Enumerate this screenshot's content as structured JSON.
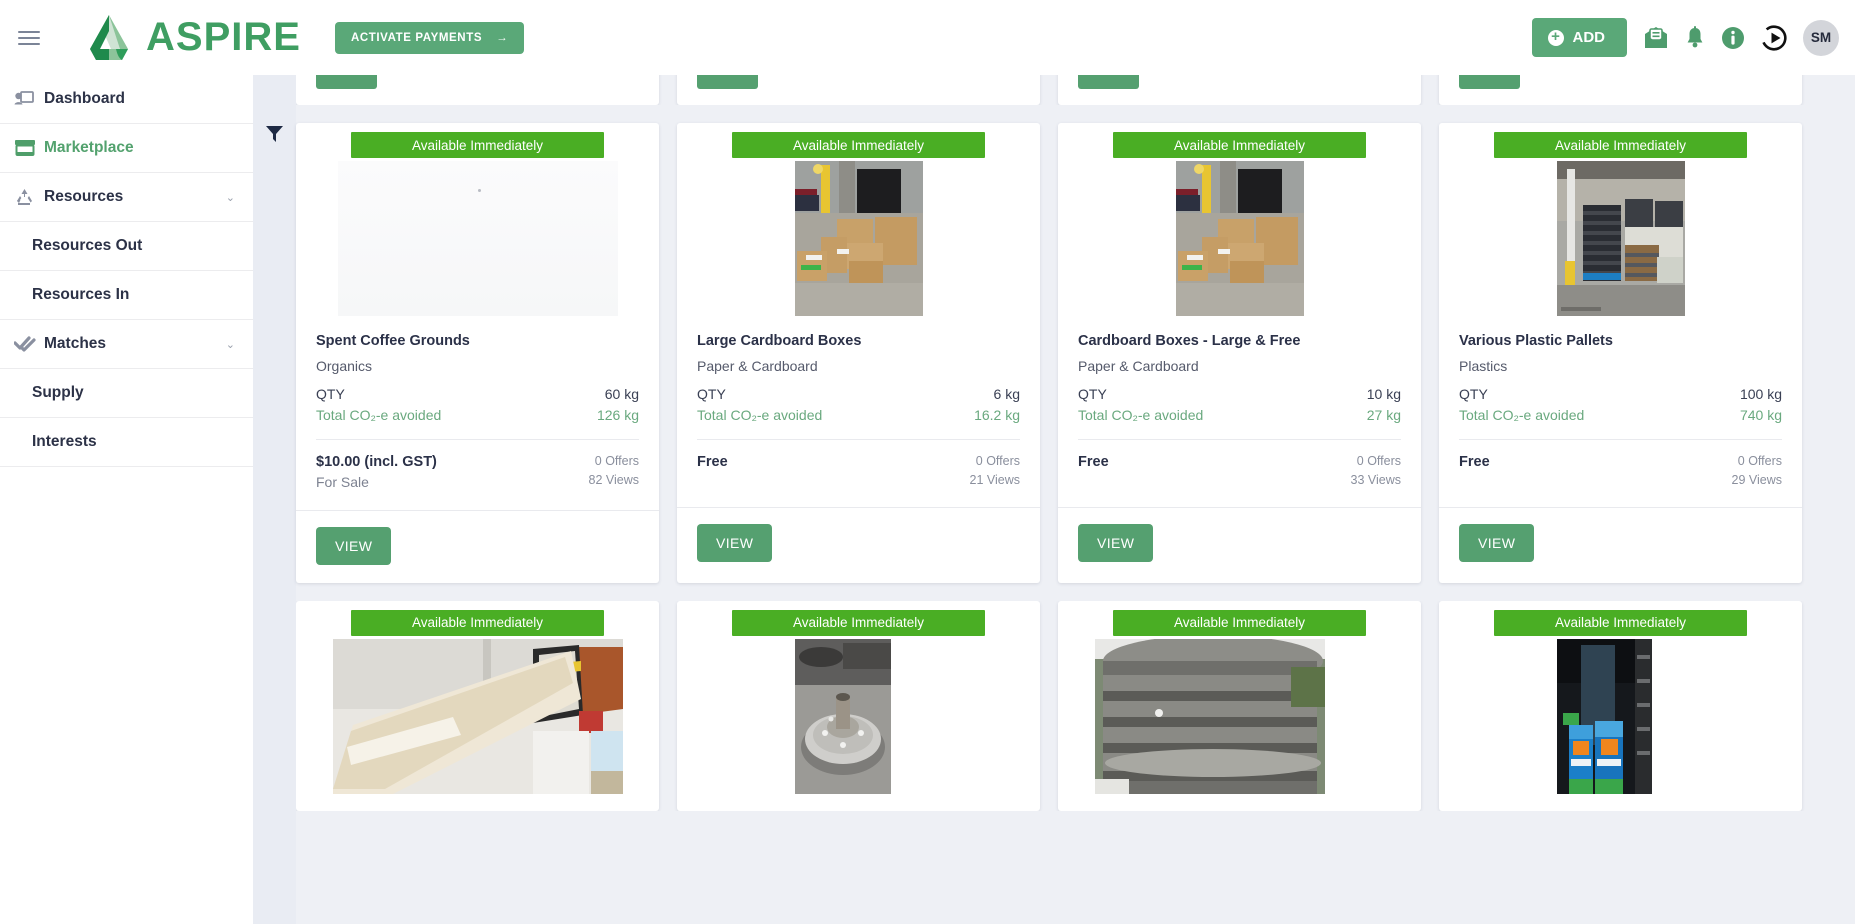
{
  "header": {
    "brand_name": "ASPIRE",
    "activate_label": "ACTIVATE PAYMENTS",
    "activate_arrow": "→",
    "add_label": "ADD",
    "avatar_initials": "SM",
    "icons": [
      "menu-icon",
      "aspire-logo-icon",
      "message-icon",
      "bell-icon",
      "info-icon",
      "play-icon"
    ]
  },
  "sidebar": {
    "items": [
      {
        "label": "Dashboard",
        "icon": "dashboard-icon",
        "active": false,
        "sub": false,
        "chevron": ""
      },
      {
        "label": "Marketplace",
        "icon": "store-icon",
        "active": true,
        "sub": false,
        "chevron": ""
      },
      {
        "label": "Resources",
        "icon": "recycle-icon",
        "active": false,
        "sub": false,
        "chevron": "⌄"
      },
      {
        "label": "Resources Out",
        "icon": "",
        "active": false,
        "sub": true,
        "chevron": ""
      },
      {
        "label": "Resources In",
        "icon": "",
        "active": false,
        "sub": true,
        "chevron": ""
      },
      {
        "label": "Matches",
        "icon": "double-check-icon",
        "active": false,
        "sub": false,
        "chevron": "⌄"
      },
      {
        "label": "Supply",
        "icon": "",
        "active": false,
        "sub": true,
        "chevron": ""
      },
      {
        "label": "Interests",
        "icon": "",
        "active": false,
        "sub": true,
        "chevron": ""
      }
    ]
  },
  "main": {
    "filter_icon": "filter-funnel-icon",
    "view_label": "VIEW",
    "badge_label": "Available Immediately",
    "qty_label": "QTY",
    "co2_label": "Total CO₂-e avoided",
    "cards": [
      {
        "title": "Spent Coffee Grounds",
        "category": "Organics",
        "qty": "60 kg",
        "co2": "126 kg",
        "price": "$10.00 (incl. GST)",
        "price_sub": "For Sale",
        "offers": "0 Offers",
        "views": "82 Views",
        "image": "blank-placeholder"
      },
      {
        "title": "Large Cardboard Boxes",
        "category": "Paper & Cardboard",
        "qty": "6 kg",
        "co2": "16.2 kg",
        "price": "Free",
        "price_sub": "",
        "offers": "0 Offers",
        "views": "21 Views",
        "image": "cardboard-boxes-photo"
      },
      {
        "title": "Cardboard Boxes - Large & Free",
        "category": "Paper & Cardboard",
        "qty": "10 kg",
        "co2": "27 kg",
        "price": "Free",
        "price_sub": "",
        "offers": "0 Offers",
        "views": "33 Views",
        "image": "cardboard-boxes-photo"
      },
      {
        "title": "Various Plastic Pallets",
        "category": "Plastics",
        "qty": "100 kg",
        "co2": "740 kg",
        "price": "Free",
        "price_sub": "",
        "offers": "0 Offers",
        "views": "29 Views",
        "image": "plastic-pallets-photo"
      }
    ],
    "bottom_cards": [
      {
        "badge": "Available Immediately",
        "image": "white-roll-photo"
      },
      {
        "badge": "Available Immediately",
        "image": "brake-drum-photo"
      },
      {
        "badge": "Available Immediately",
        "image": "tyres-photo"
      },
      {
        "badge": "Available Immediately",
        "image": "wall-insulation-photo"
      }
    ]
  },
  "colors": {
    "brand_green": "#3f9e62",
    "badge_green": "#4aae24",
    "button_green": "#55a070",
    "page_bg": "#eef0f5"
  }
}
